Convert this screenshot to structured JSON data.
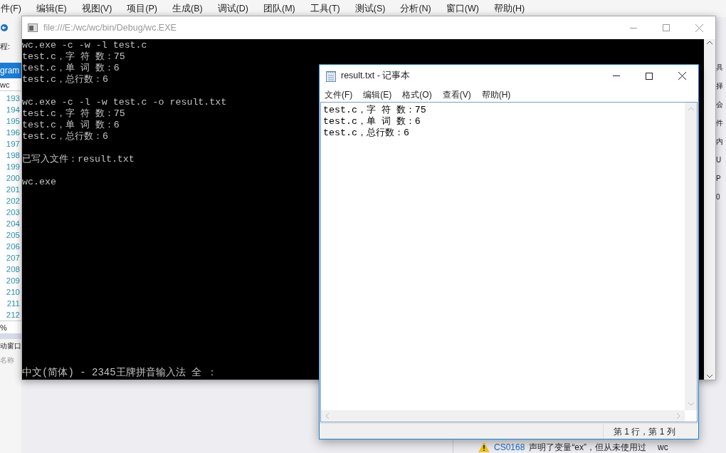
{
  "ide": {
    "menu": [
      "件(F)",
      "编辑(E)",
      "视图(V)",
      "项目(P)",
      "生成(B)",
      "调试(D)",
      "团队(M)",
      "工具(T)",
      "测试(S)",
      "分析(N)",
      "窗口(W)",
      "帮助(H)"
    ],
    "left_panel": {
      "process_label": "程:",
      "project_tab": "gram",
      "project_name": "wc",
      "line_numbers": [
        "193",
        "194",
        "195",
        "196",
        "197",
        "198",
        "199",
        "200",
        "201",
        "202",
        "203",
        "204",
        "205",
        "206",
        "207",
        "208",
        "209",
        "210",
        "211",
        "212"
      ],
      "zoom": "%",
      "window_label": "动窗口",
      "name_label": "名称"
    },
    "right_panel": [
      "具",
      "择",
      "会",
      "件",
      "内",
      "U",
      "P",
      "0"
    ],
    "error_row": {
      "code": "CS0168",
      "message": "声明了变量“ex”，但从未使用过",
      "project": "wc"
    }
  },
  "console": {
    "title": "file:///E:/wc/wc/bin/Debug/wc.EXE",
    "blocks": [
      [
        "wc.exe -c -w -l test.c",
        "test.c，字 符 数：75",
        "test.c，单 词 数：6",
        "test.c，总行数：6"
      ],
      [
        "wc.exe -c -l -w test.c -o result.txt",
        "test.c，字 符 数：75",
        "test.c，单 词 数：6",
        "test.c，总行数：6"
      ],
      [
        "已写入文件：result.txt"
      ],
      [
        "wc.exe"
      ]
    ],
    "ime_status": "中文(简体) - 2345王牌拼音输入法 全 ："
  },
  "notepad": {
    "title": "result.txt - 记事本",
    "menu": [
      "文件(F)",
      "编辑(E)",
      "格式(O)",
      "查看(V)",
      "帮助(H)"
    ],
    "lines": [
      "test.c，字 符 数：75",
      "test.c，单 词 数：6",
      "test.c，总行数：6"
    ],
    "status": "第 1 行，第 1 列"
  }
}
